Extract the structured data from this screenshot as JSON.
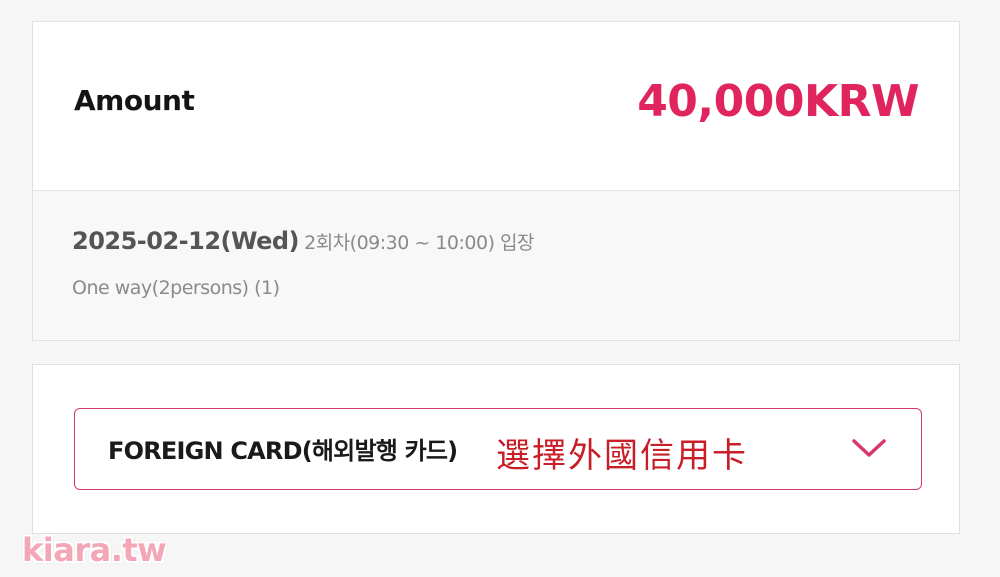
{
  "summary": {
    "amount_label": "Amount",
    "amount_value": "40,000KRW",
    "date": "2025-02-12(Wed)",
    "session": "2회차(09:30 ~ 10:00) 입장",
    "ticket": "One way(2persons) (1)"
  },
  "payment": {
    "selected_method": "FOREIGN CARD(해외발행 카드)",
    "dropdown_icon": "chevron-down-icon"
  },
  "annotation": {
    "text": "選擇外國信用卡"
  },
  "watermark": {
    "text": "kiara.tw"
  },
  "colors": {
    "accent": "#e0245e",
    "select_border": "#d63a6a",
    "annotation": "#c81e28",
    "watermark": "#f3a7b6"
  }
}
